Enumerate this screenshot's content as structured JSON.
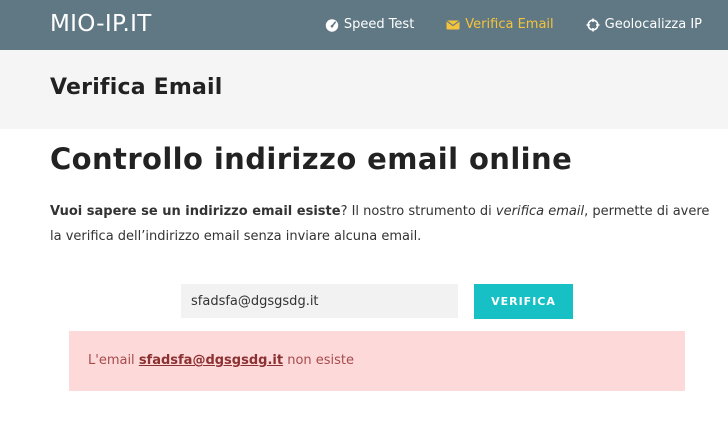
{
  "brand": "MIO-IP.IT",
  "nav": {
    "items": [
      {
        "label": "Speed Test",
        "icon": "speedometer-icon",
        "active": false
      },
      {
        "label": "Verifica Email",
        "icon": "envelope-icon",
        "active": true
      },
      {
        "label": "Geolocalizza IP",
        "icon": "crosshairs-icon",
        "active": false
      }
    ],
    "active_color": "#f5c33b"
  },
  "page_title": "Verifica Email",
  "main": {
    "heading": "Controllo indirizzo email online",
    "intro_bold": "Vuoi sapere se un indirizzo email esiste",
    "intro_after_bold": "? Il nostro strumento di ",
    "intro_italic": "verifica email",
    "intro_rest": ", permette di avere la verifica dell’indirizzo email senza inviare alcuna email."
  },
  "form": {
    "email_value": "sfadsfa@dgsgsdg.it",
    "button_label": "VERIFICA",
    "button_color": "#17c0c4"
  },
  "alert": {
    "prefix": "L'email ",
    "email": "sfadsfa@dgsgsdg.it",
    "suffix": " non esiste",
    "background": "#fed9da"
  }
}
